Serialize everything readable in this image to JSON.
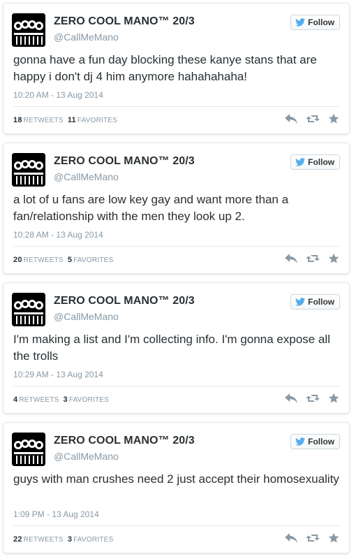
{
  "tweets": [
    {
      "name": "ZERO COOL MANO™ 20/3",
      "handle": "@CallMeMano",
      "follow_label": "Follow",
      "text": "gonna have a fun day blocking these kanye stans that are happy i don't dj 4 him anymore hahahahaha!",
      "time": "10:20 AM - 13 Aug 2014",
      "retweets_count": "18",
      "retweets_label": "RETWEETS",
      "favorites_count": "11",
      "favorites_label": "FAVORITES"
    },
    {
      "name": "ZERO COOL MANO™ 20/3",
      "handle": "@CallMeMano",
      "follow_label": "Follow",
      "text": "a lot of u fans are low key gay and want more than a fan/relationship with the men they look up 2.",
      "time": "10:28 AM - 13 Aug 2014",
      "retweets_count": "20",
      "retweets_label": "RETWEETS",
      "favorites_count": "5",
      "favorites_label": "FAVORITES"
    },
    {
      "name": "ZERO COOL MANO™ 20/3",
      "handle": "@CallMeMano",
      "follow_label": "Follow",
      "text": "I'm making a list and I'm collecting info. I'm gonna expose all the trolls",
      "time": "10:29 AM - 13 Aug 2014",
      "retweets_count": "4",
      "retweets_label": "RETWEETS",
      "favorites_count": "3",
      "favorites_label": "FAVORITES"
    },
    {
      "name": "ZERO COOL MANO™ 20/3",
      "handle": "@CallMeMano",
      "follow_label": "Follow",
      "text": "guys with man crushes need 2 just accept their homosexuality",
      "time": "1:09 PM - 13 Aug 2014",
      "retweets_count": "22",
      "retweets_label": "RETWEETS",
      "favorites_count": "3",
      "favorites_label": "FAVORITES"
    }
  ],
  "colors": {
    "bird": "#55acee",
    "muted": "#8899a6",
    "action_icon": "#8899a6",
    "border": "#e1e8ed"
  },
  "icons": {
    "follow": "twitter-bird-icon",
    "reply": "reply-icon",
    "retweet": "retweet-icon",
    "favorite": "star-icon"
  }
}
